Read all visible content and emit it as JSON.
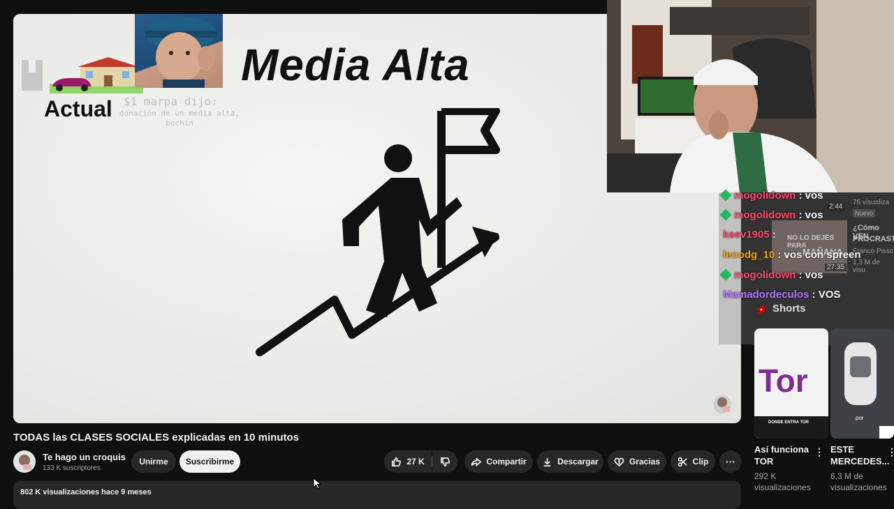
{
  "video": {
    "title_art": "Media Alta",
    "actual_label": "Actual",
    "donation_head": "$1 marpa dijo:",
    "donation_msg": "donación de un media alta, bochin"
  },
  "chat": {
    "messages": [
      {
        "user": "mogolidown",
        "text": ": vos",
        "color": "#ff4d6d",
        "badge": true
      },
      {
        "user": "mogolidown",
        "text": ": vos",
        "color": "#ff4d6d",
        "badge": true
      },
      {
        "user": "keev1905",
        "text": ":",
        "color": "#ff4d6d",
        "badge": false
      },
      {
        "user": "leoodg_10",
        "text": ": vos con spreen",
        "color": "#f5a623",
        "badge": false
      },
      {
        "user": "mogolidown",
        "text": ": vos",
        "color": "#ff4d6d",
        "badge": true
      },
      {
        "user": "Mamadordeculos",
        "text": ": VOS",
        "color": "#b57bff",
        "badge": false
      }
    ]
  },
  "sidebar_behind": {
    "dur1": "2:44",
    "views1": "76 visualiza",
    "badge_new": "Nuevo",
    "title_a": "¿Cómo VEN",
    "title_b": "PROCRAST",
    "author": "Franco Pisso",
    "dur2": "27:35",
    "views2": "1,3 M de visu",
    "thumb_text_a": "NO LO DEJES PARA",
    "thumb_text_b": "MAÑANA"
  },
  "shorts": {
    "heading": "Shorts",
    "items": [
      {
        "title_l1": "Así funciona",
        "title_l2": "TOR",
        "views_l1": "292 K",
        "views_l2": "visualizaciones",
        "thumb_text": "Tor",
        "thumb_caption": "DONDE ENTRA TOR"
      },
      {
        "title_l1": "ESTE",
        "title_l2": "MERCEDES...",
        "views_l1": "6,3 M de",
        "views_l2": "visualizaciones",
        "thumb_caption": "por"
      }
    ]
  },
  "below": {
    "title": "TODAS las CLASES SOCIALES explicadas en 10 minutos",
    "channel_name": "Te hago un croquis",
    "channel_subs": "133 K suscriptores",
    "join": "Unirme",
    "subscribe": "Suscribirme",
    "likes": "27 K",
    "share": "Compartir",
    "download": "Descargar",
    "thanks": "Gracias",
    "clip": "Clip",
    "more": "···",
    "stats": "802 K visualizaciones  hace 9 meses"
  },
  "colors": {
    "bg": "#0f0f0f",
    "pill": "#272727",
    "chat_badge": "#1fba5c",
    "shorts_icon": "#cc0000"
  }
}
